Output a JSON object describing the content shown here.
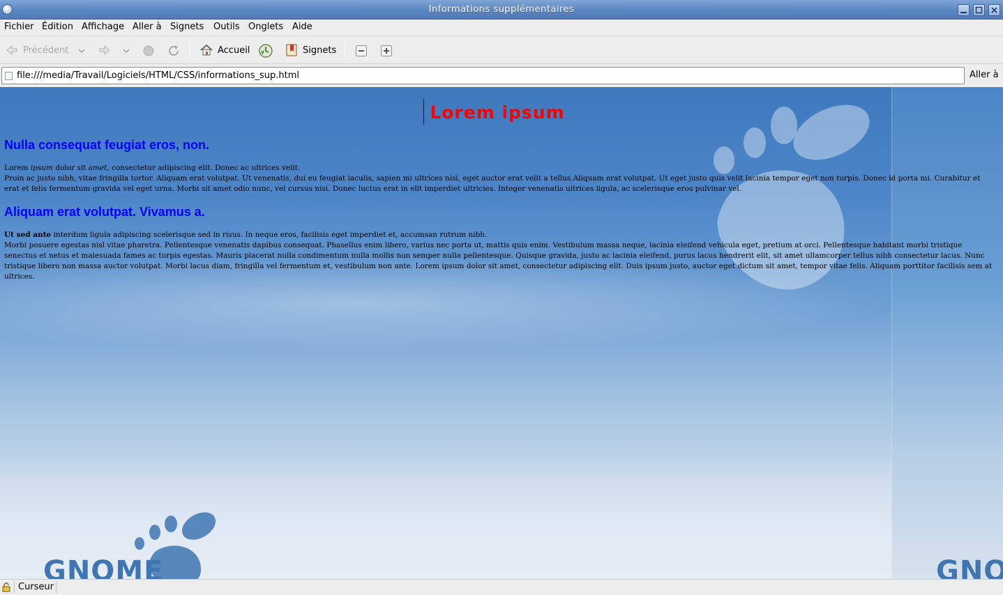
{
  "window": {
    "title": "Informations supplémentaires"
  },
  "menu": [
    "Fichier",
    "Édition",
    "Affichage",
    "Aller à",
    "Signets",
    "Outils",
    "Onglets",
    "Aide"
  ],
  "toolbar": {
    "back_label": "Précédent",
    "home_label": "Accueil",
    "bookmarks_label": "Signets"
  },
  "urlbar": {
    "url": "file:///media/Travail/Logiciels/HTML/CSS/informations_sup.html",
    "go_label": "Aller à"
  },
  "page": {
    "title": "Lorem ipsum",
    "section1": {
      "heading": "Nulla consequat feugiat eros, non.",
      "p1_a": "Lorem ",
      "p1_em1": "ipsum",
      "p1_b": " dolor sit ",
      "p1_em2": "amet",
      "p1_c": ", consectetur adipiscing elit. Donec ac ultrices velit.",
      "p1_d": "Proin ac justo nibh, vitae fringilla tortor. Aliquam erat volutpat. Ut venenatis, dui eu feugiat iaculis, sapien mi ultrices nisi, eget auctor erat velit a tellus.Aliquam erat volutpat. Ut eget justo quis velit lacinia tempor eget non turpis. Donec id porta mi. Curabitur et erat et felis fermentum gravida vel eget urna. Morbi sit amet odio nunc, vel cursus nisi. Donec luctus erat in elit imperdiet ultricies. Integer venenatis ultrices ligula, ac scelerisque eros pulvinar vel."
    },
    "section2": {
      "heading": "Aliquam erat volutpat. Vivamus a.",
      "p2_strong": "Ut sed ante",
      "p2_a": " interdum ligula adipiscing scelerisque sed in risus. In neque eros, facilisis eget imperdiet et, accumsan rutrum nibh.",
      "p2_b": "Morbi posuere egestas nisl vitae pharetra. Pellentesque venenatis dapibus consequat. Phasellus enim libero, varius nec porta ut, mattis quis enim. Vestibulum massa neque, lacinia eleifend vehicula eget, pretium at orci. Pellentesque habitant morbi tristique senectus et netus et malesuada fames ac turpis egestas. Mauris placerat nulla condimentum nulla mollis non semper nulla pellentesque. Quisque gravida, justo ac lacinia eleifend, purus lacus hendrerit elit, sit amet ullamcorper tellus nibh consectetur lacus. Nunc tristique libero non massa auctor volutpat. Morbi lacus diam, fringilla vel fermentum et, vestibulum non ante. Lorem ipsum dolor sit amet, consectetur adipiscing elit. Duis ipsum justo, auctor eget dictum sit amet, tempor vitae felis. Aliquam porttitor facilisis sem at ultrices."
    }
  },
  "wallpaper": {
    "brand_left": "GNOME",
    "brand_right": "GNO"
  },
  "statusbar": {
    "text": "Curseur"
  }
}
